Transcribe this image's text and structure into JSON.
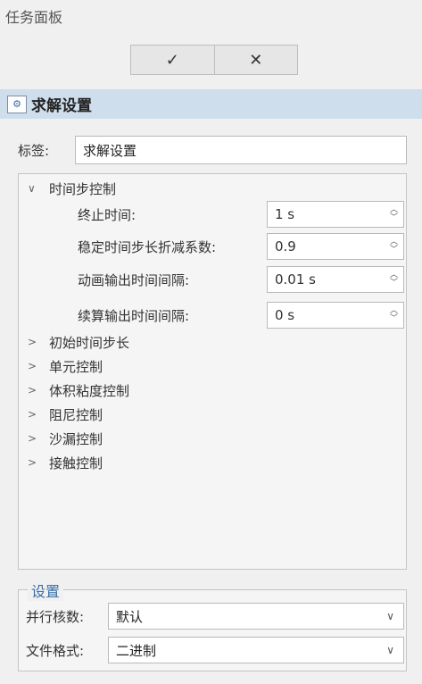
{
  "panel": {
    "title": "任务面板"
  },
  "toolbar": {
    "ok_symbol": "✓",
    "cancel_symbol": "✕"
  },
  "section": {
    "icon_glyph": "⚙",
    "title": "求解设置"
  },
  "label_field": {
    "label": "标签:",
    "value": "求解设置"
  },
  "tree": {
    "expanded_group": {
      "label": "时间步控制",
      "expanded": true,
      "properties": [
        {
          "label": "终止时间:",
          "value": "1 s"
        },
        {
          "label": "稳定时间步长折减系数:",
          "value": "0.9"
        },
        {
          "label": "动画输出时间间隔:",
          "value": "0.01 s"
        },
        {
          "label": "续算输出时间间隔:",
          "value": "0 s"
        }
      ]
    },
    "collapsed_groups": [
      {
        "label": "初始时间步长"
      },
      {
        "label": "单元控制"
      },
      {
        "label": "体积粘度控制"
      },
      {
        "label": "阻尼控制"
      },
      {
        "label": "沙漏控制"
      },
      {
        "label": "接触控制"
      }
    ]
  },
  "settings": {
    "title": "设置",
    "rows": [
      {
        "label": "并行核数:",
        "value": "默认"
      },
      {
        "label": "文件格式:",
        "value": "二进制"
      }
    ]
  },
  "icons": {
    "chevron_collapsed": ">",
    "chevron_expanded": "∨",
    "spin_up": "︿",
    "spin_down": "﹀",
    "dropdown": "∨"
  }
}
